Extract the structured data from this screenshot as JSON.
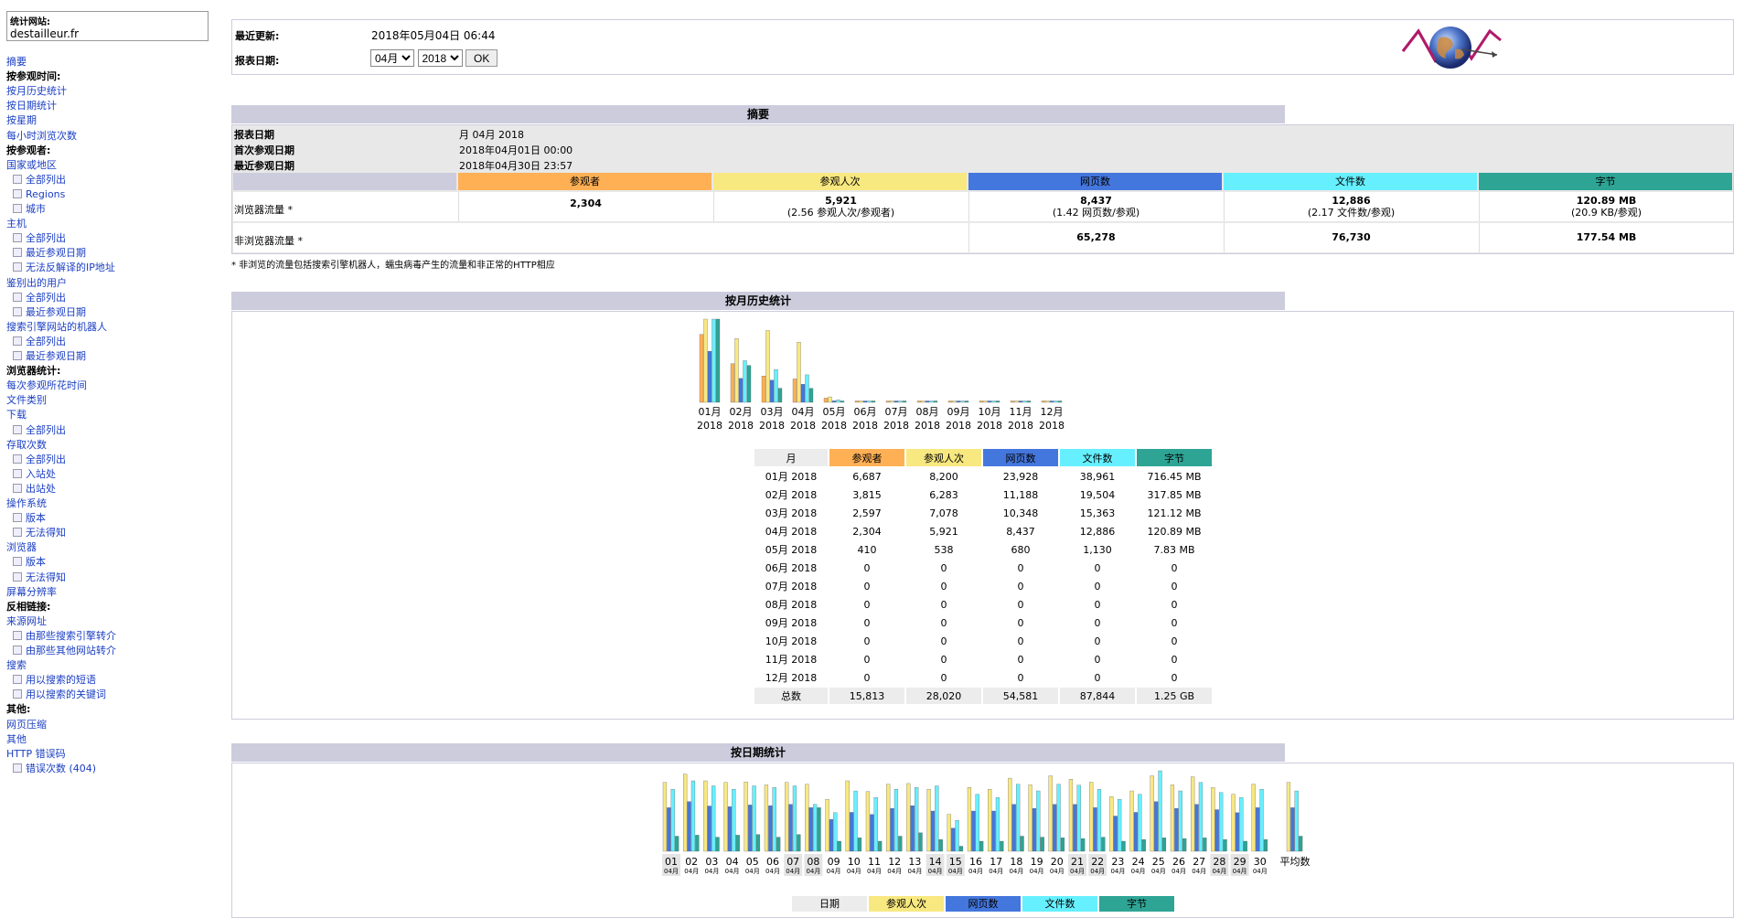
{
  "sidebar": {
    "site_label": "统计网站:",
    "site_value": "destailleur.fr",
    "items": [
      {
        "label": "摘要",
        "type": "link"
      },
      {
        "label": "按参观时间:",
        "type": "header"
      },
      {
        "label": "按月历史统计",
        "type": "link"
      },
      {
        "label": "按日期统计",
        "type": "link"
      },
      {
        "label": "按星期",
        "type": "link"
      },
      {
        "label": "每小时浏览次数",
        "type": "link"
      },
      {
        "label": "按参观者:",
        "type": "header"
      },
      {
        "label": "国家或地区",
        "type": "link"
      },
      {
        "label": "全部列出",
        "type": "sub"
      },
      {
        "label": "Regions",
        "type": "sub"
      },
      {
        "label": "城市",
        "type": "sub"
      },
      {
        "label": "主机",
        "type": "link"
      },
      {
        "label": "全部列出",
        "type": "sub"
      },
      {
        "label": "最近参观日期",
        "type": "sub"
      },
      {
        "label": "无法反解译的IP地址",
        "type": "sub"
      },
      {
        "label": "鉴别出的用户",
        "type": "link"
      },
      {
        "label": "全部列出",
        "type": "sub"
      },
      {
        "label": "最近参观日期",
        "type": "sub"
      },
      {
        "label": "搜索引擎网站的机器人",
        "type": "link"
      },
      {
        "label": "全部列出",
        "type": "sub"
      },
      {
        "label": "最近参观日期",
        "type": "sub"
      },
      {
        "label": "浏览器统计:",
        "type": "header"
      },
      {
        "label": "每次参观所花时间",
        "type": "link"
      },
      {
        "label": "文件类别",
        "type": "link"
      },
      {
        "label": "下载",
        "type": "link"
      },
      {
        "label": "全部列出",
        "type": "sub"
      },
      {
        "label": "存取次数",
        "type": "link"
      },
      {
        "label": "全部列出",
        "type": "sub"
      },
      {
        "label": "入站处",
        "type": "sub"
      },
      {
        "label": "出站处",
        "type": "sub"
      },
      {
        "label": "操作系统",
        "type": "link"
      },
      {
        "label": "版本",
        "type": "sub"
      },
      {
        "label": "无法得知",
        "type": "sub"
      },
      {
        "label": "浏览器",
        "type": "link"
      },
      {
        "label": "版本",
        "type": "sub"
      },
      {
        "label": "无法得知",
        "type": "sub"
      },
      {
        "label": "屏幕分辨率",
        "type": "link"
      },
      {
        "label": "反相链接:",
        "type": "header"
      },
      {
        "label": "来源网址",
        "type": "link"
      },
      {
        "label": "由那些搜索引擎转介",
        "type": "sub"
      },
      {
        "label": "由那些其他网站转介",
        "type": "sub"
      },
      {
        "label": "搜索",
        "type": "link"
      },
      {
        "label": "用以搜索的短语",
        "type": "sub"
      },
      {
        "label": "用以搜索的关键词",
        "type": "sub"
      },
      {
        "label": "其他:",
        "type": "header"
      },
      {
        "label": "网页压缩",
        "type": "link"
      },
      {
        "label": "其他",
        "type": "link"
      },
      {
        "label": "HTTP 错误码",
        "type": "link"
      },
      {
        "label": "错误次数 (404)",
        "type": "sub"
      }
    ]
  },
  "header": {
    "last_update_label": "最近更新:",
    "last_update_value": "2018年05月04日 06:44",
    "report_date_label": "报表日期:",
    "month_selected": "04月",
    "year_selected": "2018",
    "ok_label": "OK"
  },
  "summary": {
    "title": "摘要",
    "period_label": "报表日期",
    "period_value": "月 04月 2018",
    "first_visit_label": "首次参观日期",
    "first_visit_value": "2018年04月01日 00:00",
    "last_visit_label": "最近参观日期",
    "last_visit_value": "2018年04月30日 23:57",
    "col_visitors": "参观者",
    "col_visits": "参观人次",
    "col_pages": "网页数",
    "col_hits": "文件数",
    "col_bytes": "字节",
    "viewed_label": "浏览器流量 *",
    "viewed_visitors": "2,304",
    "viewed_visits": "5,921",
    "viewed_visits_sub": "(2.56 参观人次/参观者)",
    "viewed_pages": "8,437",
    "viewed_pages_sub": "(1.42 网页数/参观)",
    "viewed_hits": "12,886",
    "viewed_hits_sub": "(2.17 文件数/参观)",
    "viewed_bytes": "120.89 MB",
    "viewed_bytes_sub": "(20.9 KB/参观)",
    "notviewed_label": "非浏览器流量 *",
    "notviewed_pages": "65,278",
    "notviewed_hits": "76,730",
    "notviewed_bytes": "177.54 MB",
    "footnote": "* 非浏览的流量包括搜索引擎机器人，蠕虫病毒产生的流量和非正常的HTTP相应"
  },
  "colors": {
    "visitors": "#ffb055",
    "visits": "#f8e880",
    "pages": "#4477dd",
    "hits": "#66f0ff",
    "bytes": "#2ea495",
    "header_bg": "#ccccdd",
    "link": "#1a3ec4"
  },
  "monthly": {
    "title": "按月历史统计",
    "col_month": "月",
    "col_visitors": "参观者",
    "col_visits": "参观人次",
    "col_pages": "网页数",
    "col_hits": "文件数",
    "col_bytes": "字节",
    "total_label": "总数",
    "total": {
      "visitors": "15,813",
      "visits": "28,020",
      "pages": "54,581",
      "hits": "87,844",
      "bytes": "1.25 GB"
    }
  },
  "daily": {
    "title": "按日期统计",
    "avg_label": "平均数",
    "col_date": "日期",
    "col_visits": "参观人次",
    "col_pages": "网页数",
    "col_hits": "文件数",
    "col_bytes": "字节"
  },
  "chart_data": [
    {
      "type": "bar",
      "title": "按月历史统计",
      "categories": [
        "01月 2018",
        "02月 2018",
        "03月 2018",
        "04月 2018",
        "05月 2018",
        "06月 2018",
        "07月 2018",
        "08月 2018",
        "09月 2018",
        "10月 2018",
        "11月 2018",
        "12月 2018"
      ],
      "cat_top": [
        "01月",
        "02月",
        "03月",
        "04月",
        "05月",
        "06月",
        "07月",
        "08月",
        "09月",
        "10月",
        "11月",
        "12月"
      ],
      "cat_bottom": [
        "2018",
        "2018",
        "2018",
        "2018",
        "2018",
        "2018",
        "2018",
        "2018",
        "2018",
        "2018",
        "2018",
        "2018"
      ],
      "series": [
        {
          "name": "参观者",
          "values": [
            6687,
            3815,
            2597,
            2304,
            410,
            0,
            0,
            0,
            0,
            0,
            0,
            0
          ],
          "labels": [
            "6,687",
            "3,815",
            "2,597",
            "2,304",
            "410",
            "0",
            "0",
            "0",
            "0",
            "0",
            "0",
            "0"
          ]
        },
        {
          "name": "参观人次",
          "values": [
            8200,
            6283,
            7078,
            5921,
            538,
            0,
            0,
            0,
            0,
            0,
            0,
            0
          ],
          "labels": [
            "8,200",
            "6,283",
            "7,078",
            "5,921",
            "538",
            "0",
            "0",
            "0",
            "0",
            "0",
            "0",
            "0"
          ]
        },
        {
          "name": "网页数",
          "values": [
            23928,
            11188,
            10348,
            8437,
            680,
            0,
            0,
            0,
            0,
            0,
            0,
            0
          ],
          "labels": [
            "23,928",
            "11,188",
            "10,348",
            "8,437",
            "680",
            "0",
            "0",
            "0",
            "0",
            "0",
            "0",
            "0"
          ]
        },
        {
          "name": "文件数",
          "values": [
            38961,
            19504,
            15363,
            12886,
            1130,
            0,
            0,
            0,
            0,
            0,
            0,
            0
          ],
          "labels": [
            "38,961",
            "19,504",
            "15,363",
            "12,886",
            "1,130",
            "0",
            "0",
            "0",
            "0",
            "0",
            "0",
            "0"
          ]
        },
        {
          "name": "字节",
          "values": [
            716.45,
            317.85,
            121.12,
            120.89,
            7.83,
            0,
            0,
            0,
            0,
            0,
            0,
            0
          ],
          "labels": [
            "716.45 MB",
            "317.85 MB",
            "121.12 MB",
            "120.89 MB",
            "7.83 MB",
            "0",
            "0",
            "0",
            "0",
            "0",
            "0",
            "0"
          ]
        }
      ]
    },
    {
      "type": "bar",
      "title": "按日期统计",
      "categories": [
        "01",
        "02",
        "03",
        "04",
        "05",
        "06",
        "07",
        "08",
        "09",
        "10",
        "11",
        "12",
        "13",
        "14",
        "15",
        "16",
        "17",
        "18",
        "19",
        "20",
        "21",
        "22",
        "23",
        "24",
        "25",
        "26",
        "27",
        "28",
        "29",
        "30"
      ],
      "cat_sub": "04月",
      "weekend": [
        "01",
        "07",
        "08",
        "14",
        "15",
        "21",
        "22",
        "28",
        "29"
      ],
      "series": [
        {
          "name": "参观人次",
          "values": [
            205,
            230,
            210,
            205,
            207,
            198,
            205,
            200,
            155,
            210,
            178,
            200,
            202,
            185,
            110,
            190,
            185,
            218,
            198,
            225,
            215,
            206,
            163,
            180,
            225,
            198,
            222,
            190,
            170,
            200,
            205
          ]
        },
        {
          "name": "网页数",
          "values": [
            130,
            148,
            135,
            133,
            138,
            136,
            140,
            130,
            95,
            116,
            110,
            128,
            136,
            120,
            69,
            120,
            120,
            140,
            128,
            140,
            140,
            130,
            105,
            116,
            148,
            128,
            140,
            124,
            115,
            130,
            130
          ]
        },
        {
          "name": "文件数",
          "values": [
            185,
            210,
            195,
            185,
            195,
            190,
            195,
            140,
            115,
            180,
            160,
            185,
            190,
            195,
            92,
            170,
            160,
            200,
            180,
            200,
            197,
            185,
            155,
            170,
            240,
            180,
            205,
            175,
            160,
            185,
            180
          ]
        },
        {
          "name": "字节",
          "values": [
            45,
            48,
            42,
            48,
            50,
            42,
            50,
            130,
            30,
            40,
            30,
            45,
            55,
            35,
            15,
            30,
            30,
            45,
            42,
            40,
            38,
            42,
            30,
            35,
            40,
            38,
            40,
            35,
            30,
            35,
            45
          ]
        }
      ]
    }
  ]
}
